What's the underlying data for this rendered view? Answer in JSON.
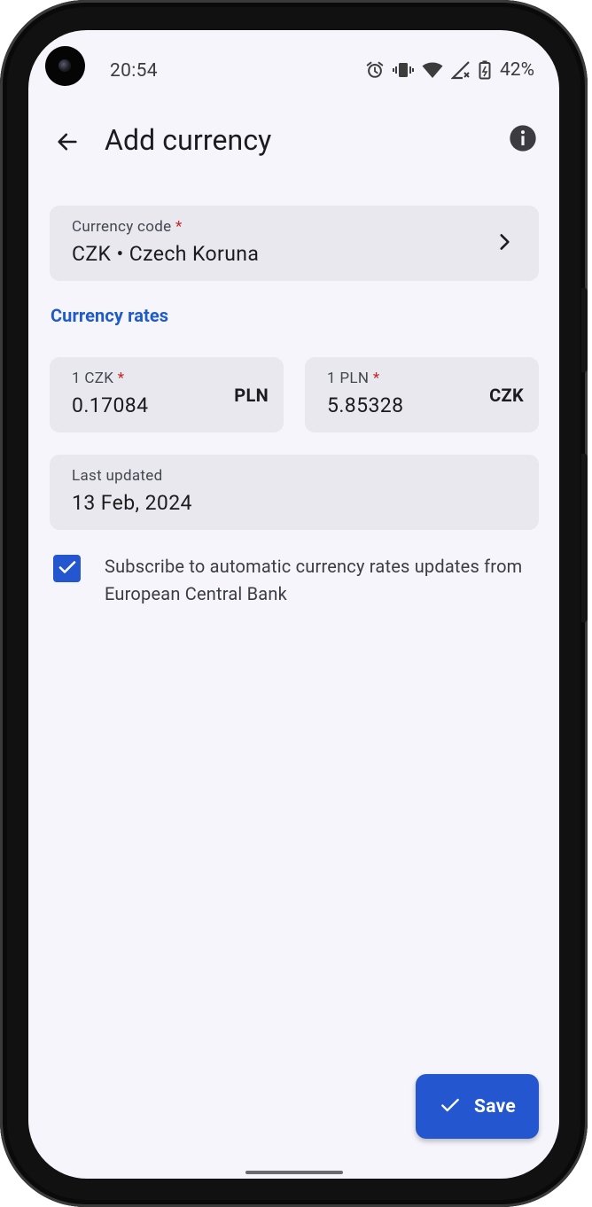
{
  "status_bar": {
    "time": "20:54",
    "battery": "42%",
    "icons": [
      "alarm-icon",
      "vibrate-icon",
      "wifi-icon",
      "signal-icon",
      "battery-icon"
    ]
  },
  "header": {
    "title": "Add currency"
  },
  "currency_code": {
    "label": "Currency code",
    "required_mark": "*",
    "value": "CZK • Czech Koruna"
  },
  "section": {
    "title": "Currency rates"
  },
  "rate_from": {
    "label": "1 CZK",
    "required_mark": "*",
    "value": "0.17084",
    "suffix": "PLN"
  },
  "rate_to": {
    "label": "1 PLN",
    "required_mark": "*",
    "value": "5.85328",
    "suffix": "CZK"
  },
  "last_updated": {
    "label": "Last updated",
    "value": "13 Feb, 2024"
  },
  "subscribe": {
    "checked": true,
    "text": "Subscribe to automatic currency rates updates from European Central Bank"
  },
  "save_button": {
    "label": "Save"
  },
  "colors": {
    "accent": "#2457cf",
    "section_title": "#1f5bc8",
    "field_bg": "#e8e8ee",
    "screen_bg": "#f6f5fb",
    "required": "#c62828"
  }
}
